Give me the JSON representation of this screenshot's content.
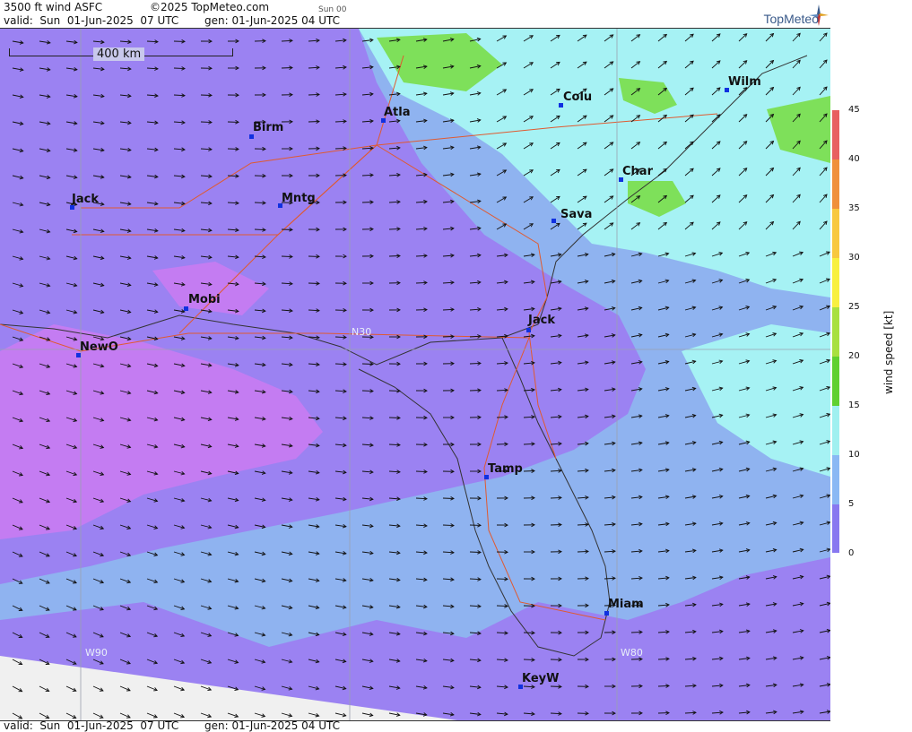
{
  "header": {
    "title": "3500 ft wind ASFC",
    "copyright": "©2025 TopMeteo.com",
    "day_tag": "Sun 00",
    "valid": "valid:  Sun  01-Jun-2025  07 UTC",
    "gen": "gen: 01-Jun-2025 04 UTC"
  },
  "footer": {
    "valid": "valid:  Sun  01-Jun-2025  07 UTC",
    "gen": "gen: 01-Jun-2025 04 UTC"
  },
  "logo": {
    "text": "TopMeteo",
    "icon": "compass-star-icon"
  },
  "scale": {
    "label": "400 km"
  },
  "grid_labels": {
    "lat": "N30",
    "lon_west": "W90",
    "lon_east": "W80"
  },
  "cities": [
    {
      "name": "Jack",
      "key": "jackson-ms"
    },
    {
      "name": "Birm",
      "key": "birmingham"
    },
    {
      "name": "Mntg",
      "key": "montgomery"
    },
    {
      "name": "Atla",
      "key": "atlanta"
    },
    {
      "name": "Colu",
      "key": "columbia"
    },
    {
      "name": "Wilm",
      "key": "wilmington"
    },
    {
      "name": "Char",
      "key": "charleston"
    },
    {
      "name": "Sava",
      "key": "savannah"
    },
    {
      "name": "Mobi",
      "key": "mobile"
    },
    {
      "name": "NewO",
      "key": "new-orleans"
    },
    {
      "name": "Jack",
      "key": "jacksonville"
    },
    {
      "name": "Tamp",
      "key": "tampa"
    },
    {
      "name": "Miam",
      "key": "miami"
    },
    {
      "name": "KeyW",
      "key": "key-west"
    }
  ],
  "colorbar": {
    "label": "wind speed [kt]",
    "ticks": [
      "45",
      "40",
      "35",
      "30",
      "25",
      "20",
      "15",
      "10",
      "5",
      "0"
    ],
    "colors": [
      "#e86060",
      "#f0903c",
      "#f8c840",
      "#f8f040",
      "#a8e040",
      "#60d030",
      "#a0f0f0",
      "#8ab8f4",
      "#8878f0",
      "#c080f0"
    ]
  },
  "colors": {
    "calm": "#c47cf2",
    "light": "#9b82f2",
    "moderate": "#8fb3f0",
    "fresh": "#a6f2f4",
    "strong": "#7ee05a",
    "road": "#e05a30",
    "border": "#333333",
    "arrow": "#111111"
  }
}
